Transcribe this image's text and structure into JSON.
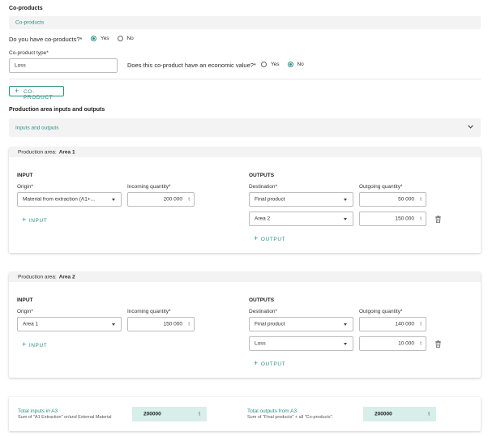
{
  "coproducts": {
    "section_title": "Co-products",
    "accordion_label": "Co-products",
    "question": "Do you have co-products?*",
    "yes": "Yes",
    "no": "No",
    "selected": "Yes",
    "type_label": "Co-product type*",
    "type_value": "Loss",
    "economic_question": "Does this co-product have an economic value?*",
    "economic_yes": "Yes",
    "economic_no": "No",
    "economic_selected": "No",
    "add_button": "CO-PRODUCT"
  },
  "production": {
    "section_title": "Production area inputs and outputs",
    "accordion_label": "Inputs and outputs",
    "area_prefix": "Production area:",
    "input_head": "INPUT",
    "outputs_head": "OUTPUTS",
    "origin_label": "Origin*",
    "incoming_label": "Incoming quantity*",
    "destination_label": "Destination*",
    "outgoing_label": "Outgoing quantity*",
    "add_input": "INPUT",
    "add_output": "OUTPUT",
    "unit": "t",
    "areas": [
      {
        "name": "Area 1",
        "origin": "Material from extraction (A1+...",
        "incoming": "200 000",
        "outputs": [
          {
            "destination": "Final product",
            "quantity": "50 000"
          },
          {
            "destination": "Area 2",
            "quantity": "150 000"
          }
        ]
      },
      {
        "name": "Area 2",
        "origin": "Area 1",
        "incoming": "150 000",
        "outputs": [
          {
            "destination": "Final product",
            "quantity": "140 000"
          },
          {
            "destination": "Loss",
            "quantity": "10 000"
          }
        ]
      }
    ]
  },
  "summary": {
    "inputs_title": "Total inputs in A3",
    "inputs_sub": "Sum of \"A1 Extraction\" or/and External Material",
    "inputs_value": "200000",
    "outputs_title": "Total outputs from A3",
    "outputs_sub": "Sum of \"Final products\" + all \"Co-products\".",
    "outputs_value": "200000",
    "unit": "t"
  },
  "colors": {
    "accent": "#2a8f86",
    "panel_gray": "#f3f3f3",
    "summary_box": "#d7eee9"
  },
  "icons": [
    "plus-icon",
    "chevron-down-icon",
    "caret-down-icon",
    "trash-icon",
    "radio-icon"
  ]
}
